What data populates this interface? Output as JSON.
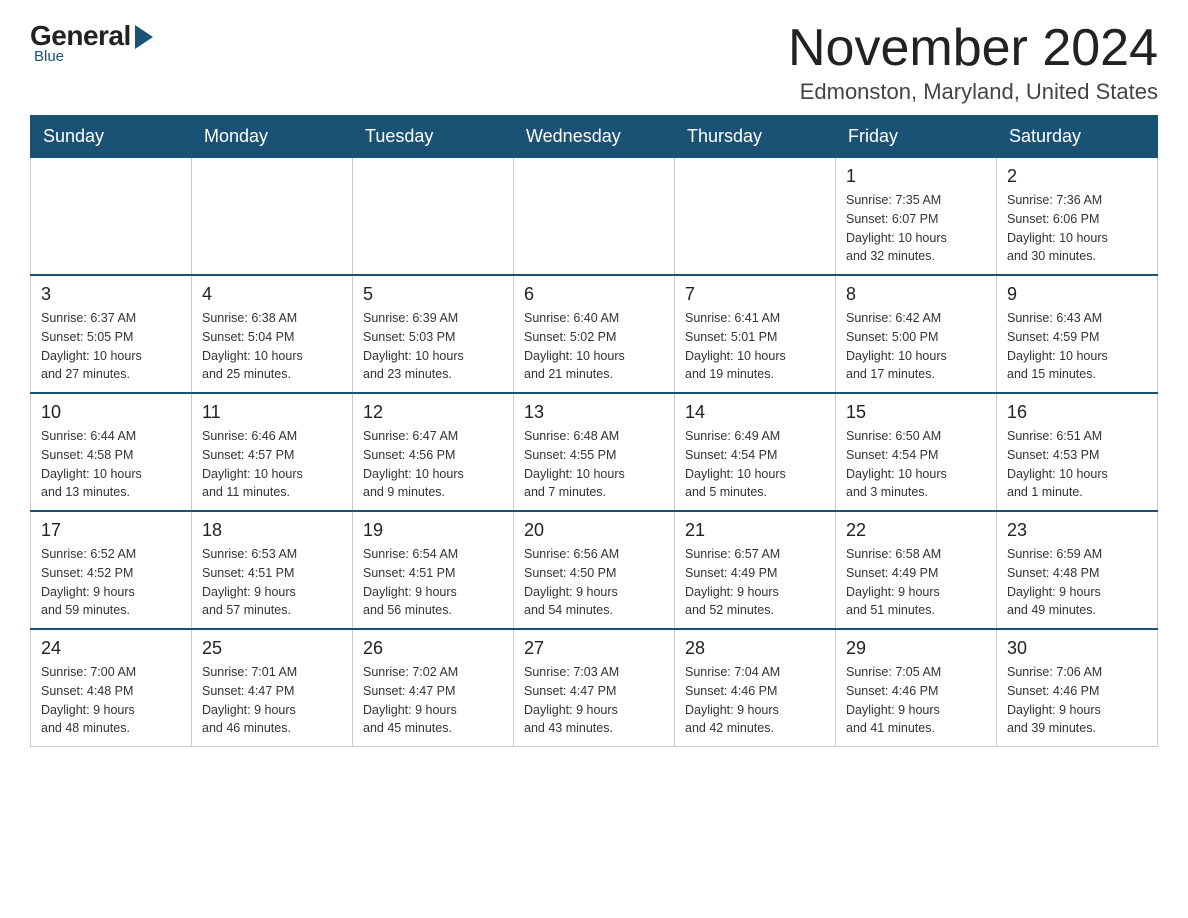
{
  "logo": {
    "general": "General",
    "blue": "Blue"
  },
  "title": {
    "month": "November 2024",
    "location": "Edmonston, Maryland, United States"
  },
  "days_of_week": [
    "Sunday",
    "Monday",
    "Tuesday",
    "Wednesday",
    "Thursday",
    "Friday",
    "Saturday"
  ],
  "weeks": [
    [
      {
        "day": "",
        "info": ""
      },
      {
        "day": "",
        "info": ""
      },
      {
        "day": "",
        "info": ""
      },
      {
        "day": "",
        "info": ""
      },
      {
        "day": "",
        "info": ""
      },
      {
        "day": "1",
        "info": "Sunrise: 7:35 AM\nSunset: 6:07 PM\nDaylight: 10 hours\nand 32 minutes."
      },
      {
        "day": "2",
        "info": "Sunrise: 7:36 AM\nSunset: 6:06 PM\nDaylight: 10 hours\nand 30 minutes."
      }
    ],
    [
      {
        "day": "3",
        "info": "Sunrise: 6:37 AM\nSunset: 5:05 PM\nDaylight: 10 hours\nand 27 minutes."
      },
      {
        "day": "4",
        "info": "Sunrise: 6:38 AM\nSunset: 5:04 PM\nDaylight: 10 hours\nand 25 minutes."
      },
      {
        "day": "5",
        "info": "Sunrise: 6:39 AM\nSunset: 5:03 PM\nDaylight: 10 hours\nand 23 minutes."
      },
      {
        "day": "6",
        "info": "Sunrise: 6:40 AM\nSunset: 5:02 PM\nDaylight: 10 hours\nand 21 minutes."
      },
      {
        "day": "7",
        "info": "Sunrise: 6:41 AM\nSunset: 5:01 PM\nDaylight: 10 hours\nand 19 minutes."
      },
      {
        "day": "8",
        "info": "Sunrise: 6:42 AM\nSunset: 5:00 PM\nDaylight: 10 hours\nand 17 minutes."
      },
      {
        "day": "9",
        "info": "Sunrise: 6:43 AM\nSunset: 4:59 PM\nDaylight: 10 hours\nand 15 minutes."
      }
    ],
    [
      {
        "day": "10",
        "info": "Sunrise: 6:44 AM\nSunset: 4:58 PM\nDaylight: 10 hours\nand 13 minutes."
      },
      {
        "day": "11",
        "info": "Sunrise: 6:46 AM\nSunset: 4:57 PM\nDaylight: 10 hours\nand 11 minutes."
      },
      {
        "day": "12",
        "info": "Sunrise: 6:47 AM\nSunset: 4:56 PM\nDaylight: 10 hours\nand 9 minutes."
      },
      {
        "day": "13",
        "info": "Sunrise: 6:48 AM\nSunset: 4:55 PM\nDaylight: 10 hours\nand 7 minutes."
      },
      {
        "day": "14",
        "info": "Sunrise: 6:49 AM\nSunset: 4:54 PM\nDaylight: 10 hours\nand 5 minutes."
      },
      {
        "day": "15",
        "info": "Sunrise: 6:50 AM\nSunset: 4:54 PM\nDaylight: 10 hours\nand 3 minutes."
      },
      {
        "day": "16",
        "info": "Sunrise: 6:51 AM\nSunset: 4:53 PM\nDaylight: 10 hours\nand 1 minute."
      }
    ],
    [
      {
        "day": "17",
        "info": "Sunrise: 6:52 AM\nSunset: 4:52 PM\nDaylight: 9 hours\nand 59 minutes."
      },
      {
        "day": "18",
        "info": "Sunrise: 6:53 AM\nSunset: 4:51 PM\nDaylight: 9 hours\nand 57 minutes."
      },
      {
        "day": "19",
        "info": "Sunrise: 6:54 AM\nSunset: 4:51 PM\nDaylight: 9 hours\nand 56 minutes."
      },
      {
        "day": "20",
        "info": "Sunrise: 6:56 AM\nSunset: 4:50 PM\nDaylight: 9 hours\nand 54 minutes."
      },
      {
        "day": "21",
        "info": "Sunrise: 6:57 AM\nSunset: 4:49 PM\nDaylight: 9 hours\nand 52 minutes."
      },
      {
        "day": "22",
        "info": "Sunrise: 6:58 AM\nSunset: 4:49 PM\nDaylight: 9 hours\nand 51 minutes."
      },
      {
        "day": "23",
        "info": "Sunrise: 6:59 AM\nSunset: 4:48 PM\nDaylight: 9 hours\nand 49 minutes."
      }
    ],
    [
      {
        "day": "24",
        "info": "Sunrise: 7:00 AM\nSunset: 4:48 PM\nDaylight: 9 hours\nand 48 minutes."
      },
      {
        "day": "25",
        "info": "Sunrise: 7:01 AM\nSunset: 4:47 PM\nDaylight: 9 hours\nand 46 minutes."
      },
      {
        "day": "26",
        "info": "Sunrise: 7:02 AM\nSunset: 4:47 PM\nDaylight: 9 hours\nand 45 minutes."
      },
      {
        "day": "27",
        "info": "Sunrise: 7:03 AM\nSunset: 4:47 PM\nDaylight: 9 hours\nand 43 minutes."
      },
      {
        "day": "28",
        "info": "Sunrise: 7:04 AM\nSunset: 4:46 PM\nDaylight: 9 hours\nand 42 minutes."
      },
      {
        "day": "29",
        "info": "Sunrise: 7:05 AM\nSunset: 4:46 PM\nDaylight: 9 hours\nand 41 minutes."
      },
      {
        "day": "30",
        "info": "Sunrise: 7:06 AM\nSunset: 4:46 PM\nDaylight: 9 hours\nand 39 minutes."
      }
    ]
  ]
}
